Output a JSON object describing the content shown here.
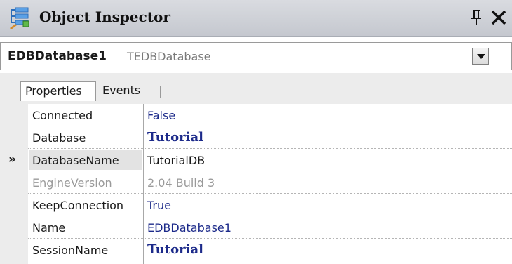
{
  "window": {
    "title": "Object Inspector"
  },
  "selector": {
    "object_name": "EDBDatabase1",
    "object_type": "TEDBDatabase"
  },
  "tabs": [
    {
      "label": "Properties",
      "active": true
    },
    {
      "label": "Events",
      "active": false
    }
  ],
  "selected_marker": "»",
  "properties": [
    {
      "name": "Connected",
      "value": "False",
      "state": "normal"
    },
    {
      "name": "Database",
      "value": "Tutorial",
      "state": "bold"
    },
    {
      "name": "DatabaseName",
      "value": "TutorialDB",
      "state": "selected"
    },
    {
      "name": "EngineVersion",
      "value": "2.04 Build 3",
      "state": "disabled"
    },
    {
      "name": "KeepConnection",
      "value": "True",
      "state": "normal"
    },
    {
      "name": "Name",
      "value": "EDBDatabase1",
      "state": "normal"
    },
    {
      "name": "SessionName",
      "value": "Tutorial",
      "state": "bold"
    }
  ],
  "colors": {
    "value_text": "#1c2a8a",
    "disabled_text": "#9a9a9a",
    "titlebar": "#cfd1d6"
  },
  "icons": [
    "object-inspector-icon",
    "pin-icon",
    "close-icon",
    "dropdown-arrow-icon"
  ]
}
